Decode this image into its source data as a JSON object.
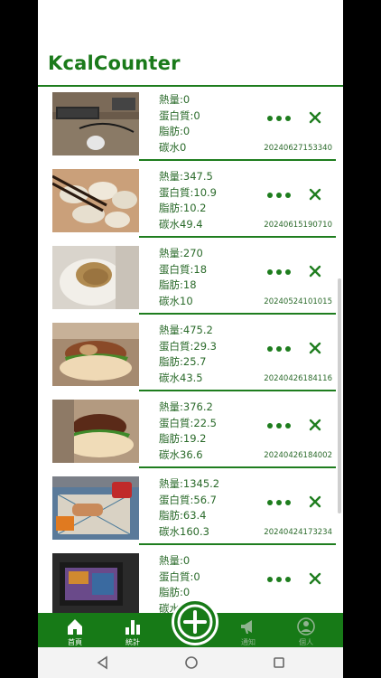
{
  "app": {
    "title": "KcalCounter"
  },
  "colors": {
    "accent": "#1e7d1e",
    "nav_bg": "#177a17",
    "text": "#2a6a2a"
  },
  "entries": [
    {
      "photo": "desk-keyboard-mouse-photo",
      "calories": "熱量:0",
      "protein": "蛋白質:0",
      "fat": "脂肪:0",
      "carbs": "碳水0",
      "timestamp": "20240627153340"
    },
    {
      "photo": "dumplings-photo",
      "calories": "熱量:347.5",
      "protein": "蛋白質:10.9",
      "fat": "脂肪:10.2",
      "carbs": "碳水49.4",
      "timestamp": "20240615190710"
    },
    {
      "photo": "bun-pork-floss-photo",
      "calories": "熱量:270",
      "protein": "蛋白質:18",
      "fat": "脂肪:18",
      "carbs": "碳水10",
      "timestamp": "20240524101015"
    },
    {
      "photo": "burger-photo",
      "calories": "熱量:475.2",
      "protein": "蛋白質:29.3",
      "fat": "脂肪:25.7",
      "carbs": "碳水43.5",
      "timestamp": "20240426184116"
    },
    {
      "photo": "burger-photo-2",
      "calories": "熱量:376.2",
      "protein": "蛋白質:22.5",
      "fat": "脂肪:19.2",
      "carbs": "碳水36.6",
      "timestamp": "20240426184002"
    },
    {
      "photo": "fastfood-tray-photo",
      "calories": "熱量:1345.2",
      "protein": "蛋白質:56.7",
      "fat": "脂肪:63.4",
      "carbs": "碳水160.3",
      "timestamp": "20240424173234"
    },
    {
      "photo": "monitor-screen-photo",
      "calories": "熱量:0",
      "protein": "蛋白質:0",
      "fat": "脂肪:0",
      "carbs": "碳水0",
      "timestamp": ""
    }
  ],
  "nav": {
    "home": "首頁",
    "stats": "統計",
    "notify": "通知",
    "profile": "個人"
  }
}
